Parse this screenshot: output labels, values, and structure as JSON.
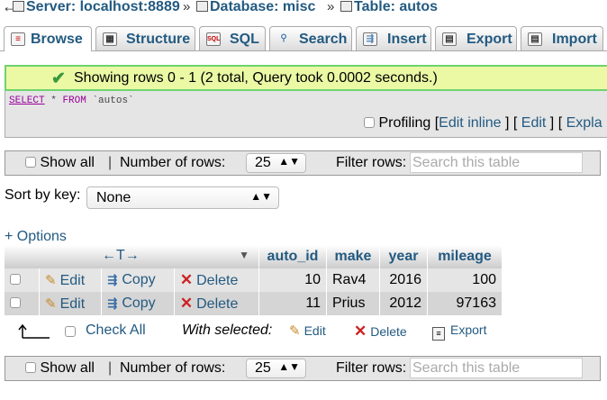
{
  "breadcrumb": {
    "back_arrow": "←",
    "server": "Server: localhost:8889",
    "database": "Database: misc",
    "table": "Table: autos",
    "separator": "»"
  },
  "tabs": [
    {
      "label": "Browse",
      "icon": "browse-icon",
      "active": true
    },
    {
      "label": "Structure",
      "icon": "structure-icon"
    },
    {
      "label": "SQL",
      "icon": "sql-icon"
    },
    {
      "label": "Search",
      "icon": "search-icon"
    },
    {
      "label": "Insert",
      "icon": "insert-icon"
    },
    {
      "label": "Export",
      "icon": "export-icon"
    },
    {
      "label": "Import",
      "icon": "import-icon"
    }
  ],
  "success_message": "Showing rows 0 - 1 (2 total, Query took 0.0002 seconds.)",
  "query": {
    "select": "SELECT",
    "star": "*",
    "from": "FROM",
    "table": "`autos`"
  },
  "query_tools": {
    "profiling": "Profiling",
    "edit_inline": "Edit inline",
    "edit": "Edit",
    "explain": "Expla"
  },
  "navigation": {
    "show_all": "Show all",
    "separator": "|",
    "number_of_rows_label": "Number of rows:",
    "number_of_rows_value": "25",
    "filter_rows_label": "Filter rows:",
    "filter_placeholder": "Search this table"
  },
  "sort": {
    "label": "Sort by key:",
    "value": "None"
  },
  "options_link": "+ Options",
  "table": {
    "arrows": "←T→",
    "columns": [
      "auto_id",
      "make",
      "year",
      "mileage"
    ],
    "actions": {
      "edit": "Edit",
      "copy": "Copy",
      "delete": "Delete"
    },
    "rows": [
      {
        "auto_id": "10",
        "make": "Rav4",
        "year": "2016",
        "mileage": "100"
      },
      {
        "auto_id": "11",
        "make": "Prius",
        "year": "2012",
        "mileage": "97163"
      }
    ]
  },
  "bottom_actions": {
    "check_all": "Check All",
    "with_selected": "With selected:",
    "edit": "Edit",
    "delete": "Delete",
    "export": "Export"
  },
  "colors": {
    "link": "#235a81",
    "success_border": "#6fd36f",
    "success_bg": "#ebf8a4",
    "row_odd": "#e5e5e5",
    "row_even": "#d5d5d5"
  }
}
